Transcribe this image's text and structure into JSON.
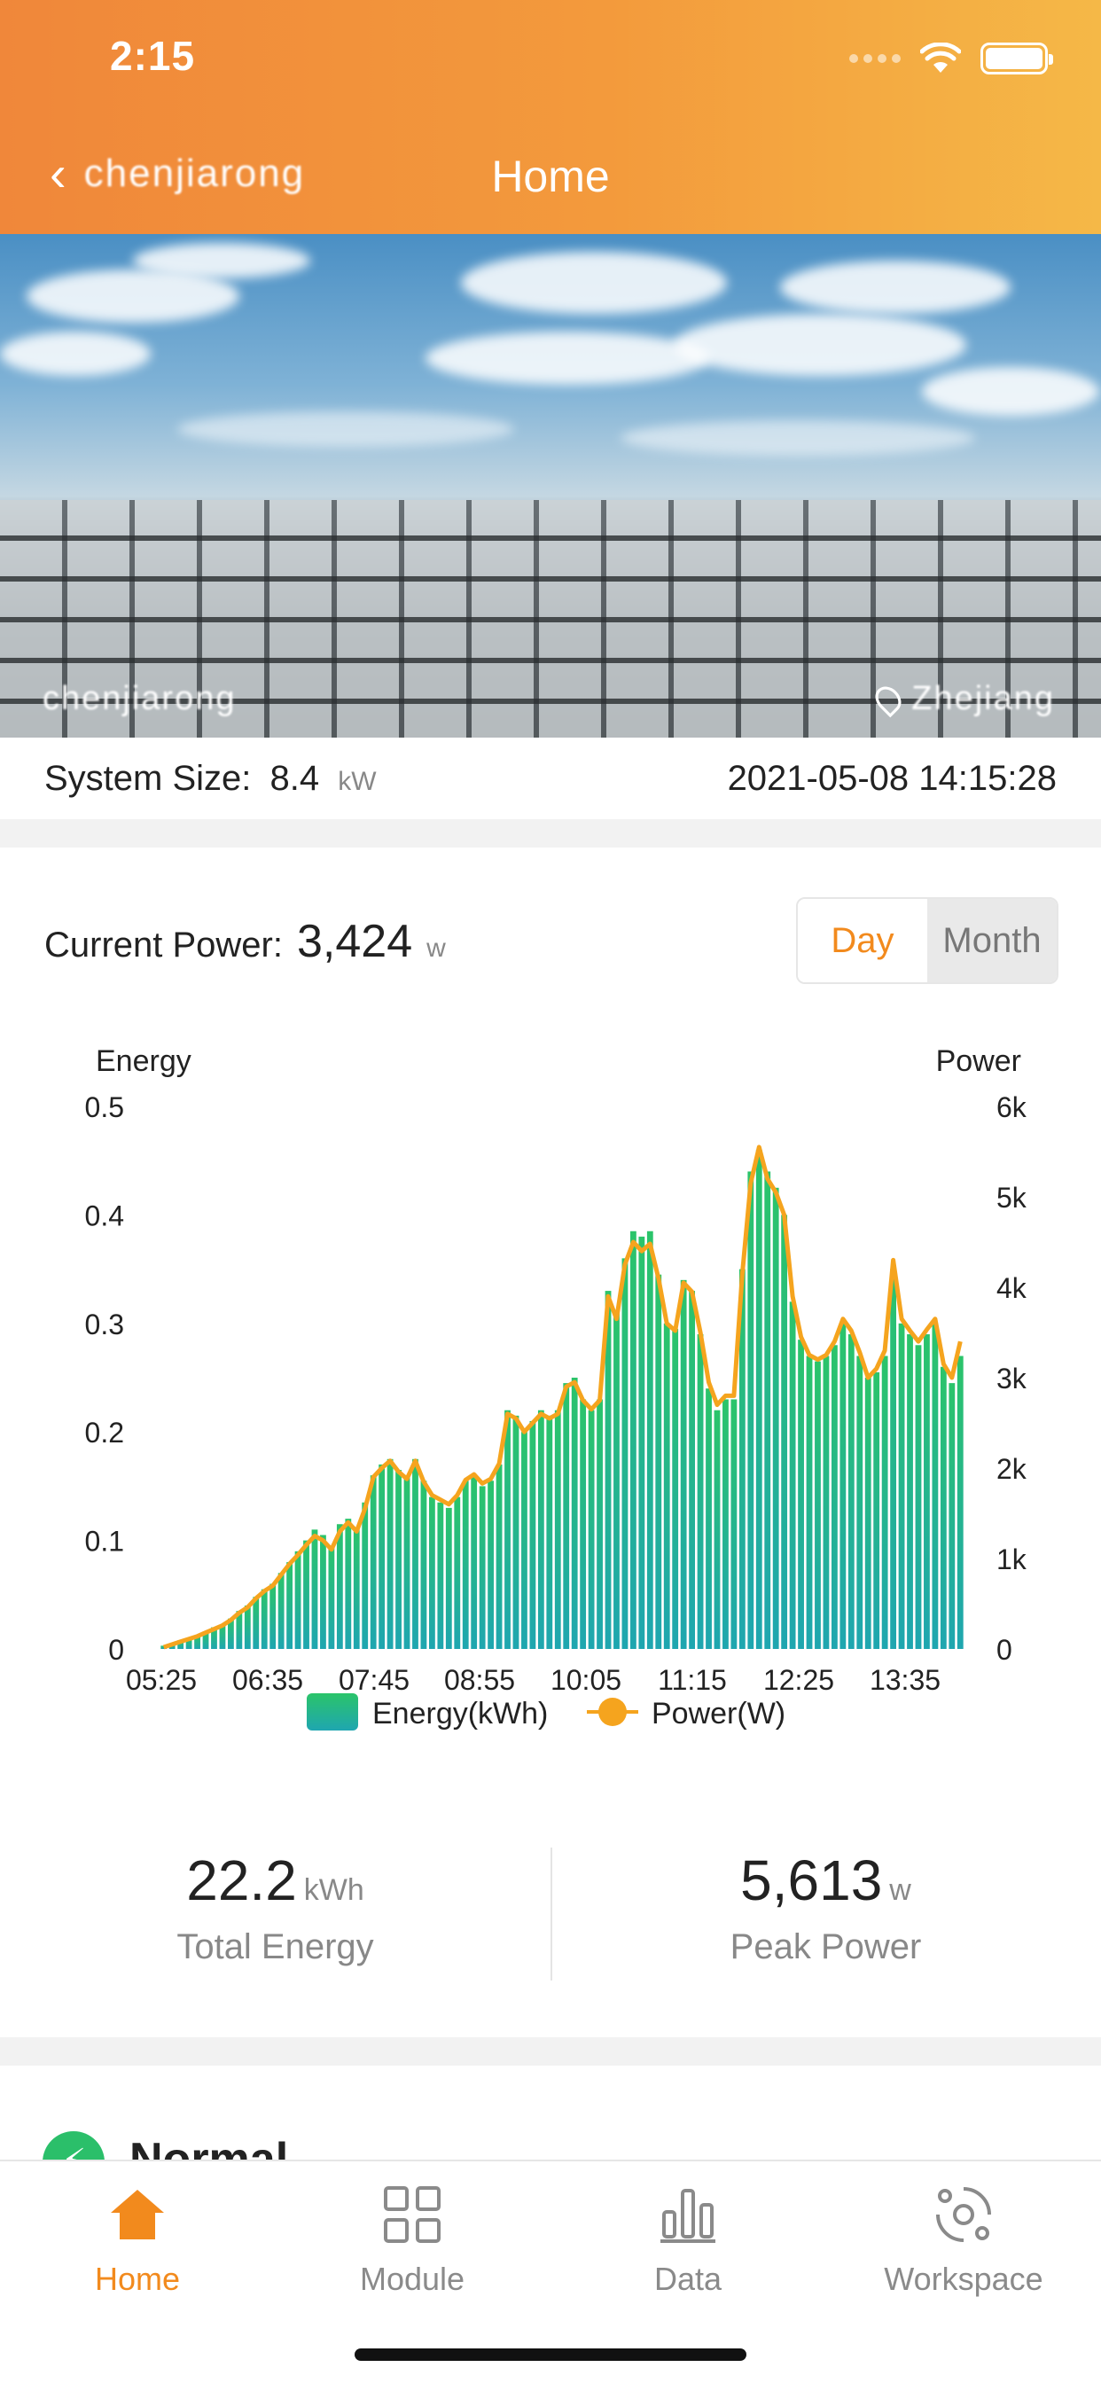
{
  "status_bar": {
    "time": "2:15"
  },
  "header": {
    "back_label": "chenjiarong",
    "title": "Home"
  },
  "banner": {
    "station_name": "chenjiarong",
    "location": "Zhejiang"
  },
  "info": {
    "system_size_label": "System Size:",
    "system_size_value": "8.4",
    "system_size_unit": "kW",
    "datetime": "2021-05-08 14:15:28"
  },
  "power": {
    "label": "Current Power:",
    "value": "3,424",
    "unit": "w"
  },
  "toggle": {
    "day": "Day",
    "month": "Month",
    "selected": "Day"
  },
  "colors": {
    "accent": "#f28a1d",
    "energy_top": "#2bc46a",
    "energy_bottom": "#1fa6b0",
    "power_line": "#f5a41e"
  },
  "chart_data": {
    "type": "bar",
    "left_axis_label": "Energy",
    "right_axis_label": "Power",
    "y_left_ticks": [
      "0.5",
      "0.4",
      "0.3",
      "0.2",
      "0.1",
      "0"
    ],
    "y_right_ticks": [
      "6k",
      "5k",
      "4k",
      "3k",
      "2k",
      "1k",
      "0"
    ],
    "ylim_left": [
      0,
      0.5
    ],
    "ylim_right": [
      0,
      6000
    ],
    "x_ticks": [
      "05:25",
      "06:35",
      "07:45",
      "08:55",
      "10:05",
      "11:15",
      "12:25",
      "13:35"
    ],
    "x_range": [
      "05:25",
      "14:10"
    ],
    "legend": [
      "Energy(kWh)",
      "Power(W)"
    ],
    "series": [
      {
        "name": "Energy(kWh)",
        "values": [
          0.003,
          0.005,
          0.008,
          0.01,
          0.012,
          0.016,
          0.02,
          0.022,
          0.028,
          0.035,
          0.04,
          0.048,
          0.055,
          0.06,
          0.07,
          0.08,
          0.09,
          0.1,
          0.11,
          0.105,
          0.095,
          0.115,
          0.12,
          0.11,
          0.135,
          0.16,
          0.17,
          0.175,
          0.165,
          0.16,
          0.175,
          0.155,
          0.14,
          0.135,
          0.13,
          0.14,
          0.155,
          0.16,
          0.15,
          0.155,
          0.17,
          0.22,
          0.215,
          0.2,
          0.21,
          0.22,
          0.215,
          0.22,
          0.245,
          0.25,
          0.23,
          0.22,
          0.23,
          0.33,
          0.31,
          0.36,
          0.385,
          0.38,
          0.385,
          0.345,
          0.3,
          0.295,
          0.34,
          0.33,
          0.29,
          0.24,
          0.22,
          0.23,
          0.23,
          0.35,
          0.44,
          0.46,
          0.44,
          0.425,
          0.4,
          0.32,
          0.285,
          0.27,
          0.265,
          0.27,
          0.28,
          0.3,
          0.29,
          0.27,
          0.25,
          0.255,
          0.27,
          0.35,
          0.3,
          0.29,
          0.28,
          0.29,
          0.3,
          0.26,
          0.245,
          0.27
        ]
      },
      {
        "name": "Power(W)",
        "values": [
          20,
          50,
          80,
          110,
          140,
          180,
          220,
          260,
          320,
          400,
          460,
          560,
          640,
          700,
          820,
          940,
          1040,
          1150,
          1250,
          1200,
          1100,
          1300,
          1400,
          1300,
          1550,
          1900,
          2000,
          2080,
          1960,
          1880,
          2080,
          1850,
          1700,
          1650,
          1600,
          1700,
          1870,
          1930,
          1830,
          1880,
          2050,
          2600,
          2550,
          2400,
          2500,
          2600,
          2550,
          2600,
          2900,
          2950,
          2750,
          2650,
          2750,
          3900,
          3650,
          4250,
          4500,
          4400,
          4480,
          4100,
          3600,
          3520,
          4050,
          3950,
          3500,
          2950,
          2700,
          2800,
          2800,
          4150,
          5150,
          5550,
          5200,
          5050,
          4800,
          3900,
          3450,
          3250,
          3200,
          3250,
          3400,
          3650,
          3520,
          3280,
          3000,
          3100,
          3300,
          4300,
          3650,
          3520,
          3400,
          3530,
          3650,
          3150,
          3000,
          3400
        ]
      }
    ]
  },
  "stats": {
    "total_energy_value": "22.2",
    "total_energy_unit": "kWh",
    "total_energy_label": "Total Energy",
    "peak_power_value": "5,613",
    "peak_power_unit": "w",
    "peak_power_label": "Peak Power"
  },
  "status_card": {
    "label": "Normal"
  },
  "tabs": [
    {
      "label": "Home",
      "icon": "home-icon"
    },
    {
      "label": "Module",
      "icon": "grid-icon"
    },
    {
      "label": "Data",
      "icon": "bar-chart-icon"
    },
    {
      "label": "Workspace",
      "icon": "workspace-icon"
    }
  ]
}
